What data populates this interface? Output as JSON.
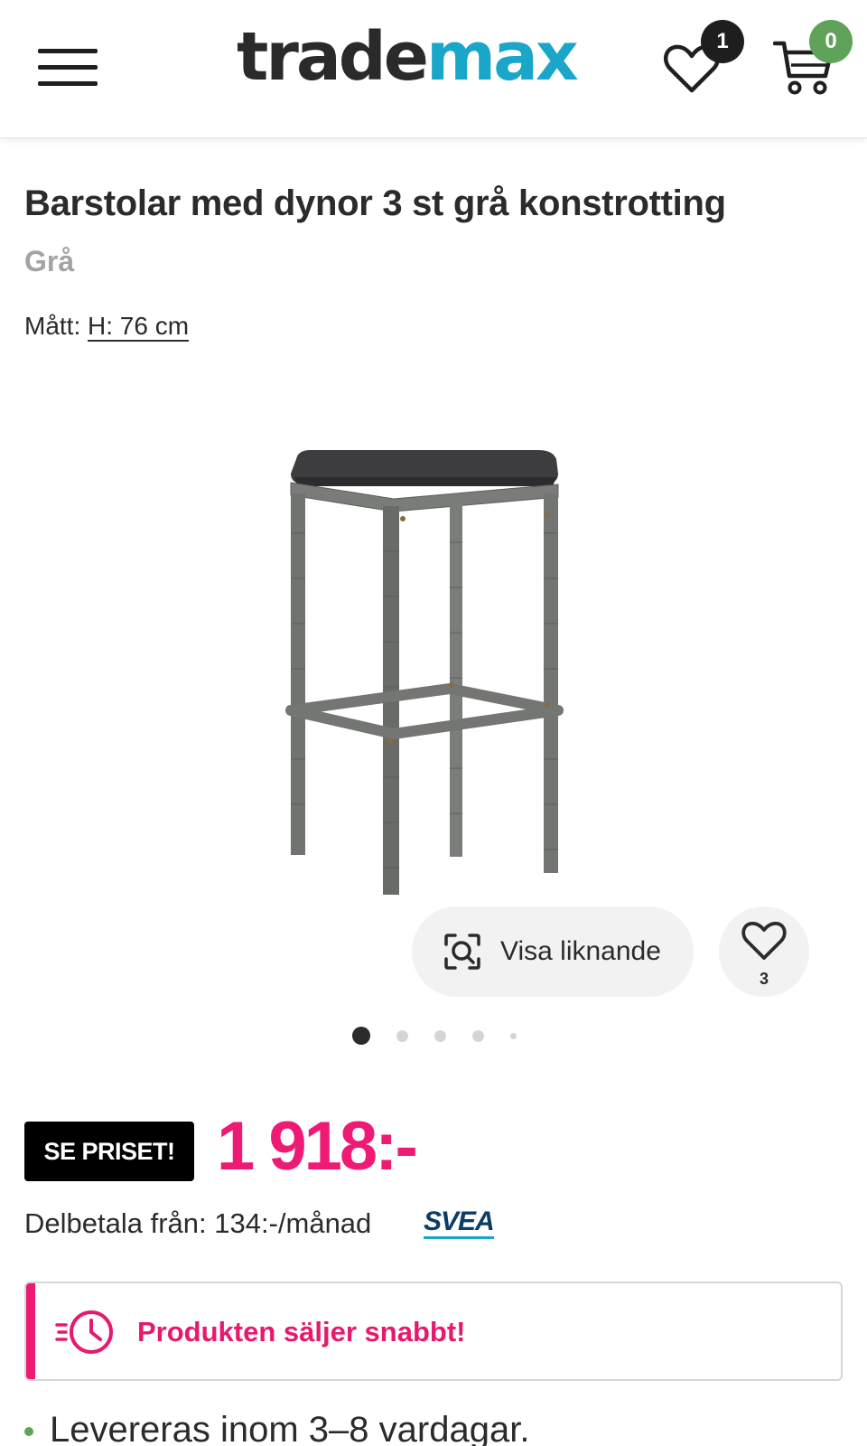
{
  "header": {
    "logo_part1": "trade",
    "logo_part2": "max",
    "wishlist_count": "1",
    "cart_count": "0"
  },
  "product": {
    "title": "Barstolar med dynor 3 st grå konstrotting",
    "color": "Grå",
    "dimensions_label": "Mått: ",
    "dimensions_value": "H: 76 cm"
  },
  "gallery": {
    "similar_label": "Visa liknande",
    "favorite_count": "3",
    "dot_count": 5,
    "active_dot": 0
  },
  "price": {
    "badge": "SE PRISET!",
    "amount": "1 918:-",
    "installment": "Delbetala från: 134:-/månad",
    "provider": "SVEA"
  },
  "alert": {
    "text": "Produkten säljer snabbt!"
  },
  "delivery": {
    "text": "Levereras inom 3–8 vardagar."
  },
  "colors": {
    "brand_dark": "#2a2a2a",
    "brand_accent": "#1aa6c9",
    "price_pink": "#ee1a74",
    "badge_green": "#5fa35a"
  },
  "icons": {
    "menu": "hamburger-icon",
    "wishlist": "heart-icon",
    "cart": "cart-icon",
    "similar": "visual-search-icon",
    "alert": "clock-icon"
  }
}
